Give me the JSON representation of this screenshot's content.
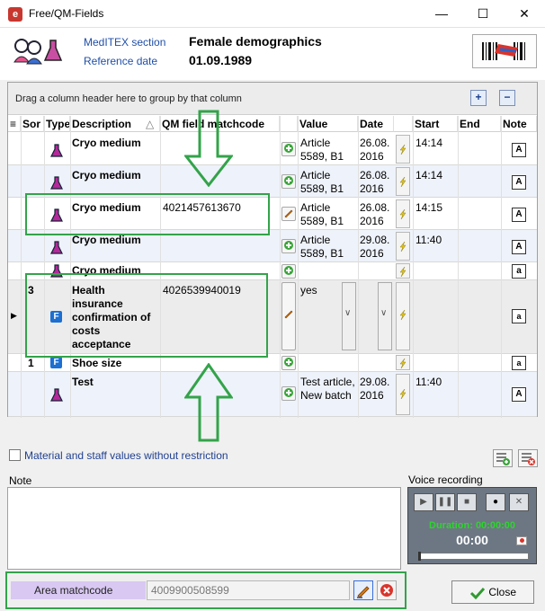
{
  "window": {
    "title": "Free/QM-Fields",
    "minimize": "—",
    "maximize": "☐",
    "close": "✕"
  },
  "header": {
    "section_label": "MedITEX section",
    "section_value": "Female demographics",
    "date_label": "Reference date",
    "date_value": "01.09.1989"
  },
  "grid": {
    "group_hint": "Drag a column header here to group by that column",
    "expand": "+",
    "collapse": "−",
    "columns": [
      "Sor",
      "Type",
      "Description",
      "QM field matchcode",
      "Value",
      "Date",
      "Start",
      "End",
      "Note"
    ],
    "rows": [
      {
        "sort": "",
        "desc": "Cryo medium",
        "matchcode": "",
        "value": "Article 5589, B1",
        "date": "26.08. 2016",
        "start": "14:14"
      },
      {
        "sort": "",
        "desc": "Cryo medium",
        "matchcode": "",
        "value": "Article 5589, B1",
        "date": "26.08. 2016",
        "start": "14:14"
      },
      {
        "sort": "",
        "desc": "Cryo medium",
        "matchcode": "4021457613670",
        "value": "Article 5589, B1",
        "date": "26.08. 2016",
        "start": "14:15"
      },
      {
        "sort": "",
        "desc": "Cryo medium",
        "matchcode": "",
        "value": "Article 5589, B1",
        "date": "29.08. 2016",
        "start": "11:40"
      },
      {
        "sort": "",
        "desc": "Cryo medium",
        "matchcode": "",
        "value": "",
        "date": "",
        "start": ""
      },
      {
        "sort": "3",
        "desc": "Health insurance confirmation of costs acceptance",
        "matchcode": "4026539940019",
        "value": "yes",
        "date": "",
        "start": ""
      },
      {
        "sort": "1",
        "desc": "Shoe size",
        "matchcode": "",
        "value": "",
        "date": "",
        "start": ""
      },
      {
        "sort": "",
        "desc": "Test",
        "matchcode": "",
        "value": "Test article, New batch",
        "date": "29.08. 2016",
        "start": "11:40"
      }
    ]
  },
  "checkbox_label": "Material and staff values without restriction",
  "note_label": "Note",
  "voice": {
    "label": "Voice recording",
    "duration": "Duration: 00:00:00",
    "time": "00:00"
  },
  "area": {
    "label": "Area matchcode",
    "value": "4009900508599"
  },
  "close_label": "Close",
  "colors": {
    "accent_green": "#33a34a",
    "link_blue": "#1f4fa8",
    "row_alt": "#eef2fa",
    "area_purple": "#d8c8f2"
  }
}
